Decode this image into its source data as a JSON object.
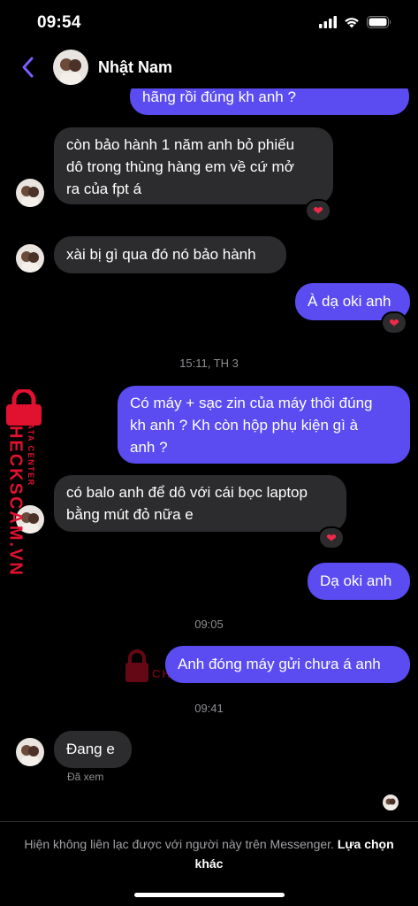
{
  "status": {
    "time": "09:54"
  },
  "header": {
    "contact_name": "Nhật Nam"
  },
  "messages": [
    {
      "dir": "out",
      "lines": [
        "hãng rồi đúng kh anh ?"
      ]
    },
    {
      "dir": "in",
      "lines": [
        "còn bảo hành 1 năm anh bỏ phiếu",
        "dô trong thùng hàng em về cứ mở",
        "ra của fpt á"
      ],
      "reaction": "heart"
    },
    {
      "dir": "in",
      "lines": [
        "xài bị gì qua đó nó bảo hành"
      ]
    },
    {
      "dir": "out",
      "lines": [
        "À dạ oki anh"
      ],
      "reaction": "heart"
    },
    {
      "dir": "out",
      "lines": [
        "Có máy + sạc zin của máy thôi đúng",
        "kh anh ? Kh còn hộp phụ kiện gì à",
        "anh ?"
      ]
    },
    {
      "dir": "in",
      "lines": [
        "có balo anh để dô với cái bọc laptop",
        "bằng mút đỏ nữa e"
      ],
      "reaction": "heart"
    },
    {
      "dir": "out",
      "lines": [
        "Dạ oki anh"
      ]
    },
    {
      "dir": "out",
      "lines": [
        "Anh đóng máy gửi chưa á anh"
      ]
    },
    {
      "dir": "in",
      "lines": [
        "Đang e"
      ]
    }
  ],
  "timestamps": [
    "15:11, TH 3",
    "09:05",
    "09:41"
  ],
  "seen_label": "Đã xem",
  "footer": {
    "notice": "Hiện không liên lạc được với người này trên Messenger.",
    "action": "Lựa chọn khác"
  },
  "watermark": {
    "brand": "CHECKSCAM.VN",
    "tagline": "DATA CENTER"
  },
  "colors": {
    "outgoing_bubble": "#5b4cf2",
    "incoming_bubble": "#2c2c2e",
    "back_icon": "#7b5cff",
    "watermark": "#e0122f"
  }
}
